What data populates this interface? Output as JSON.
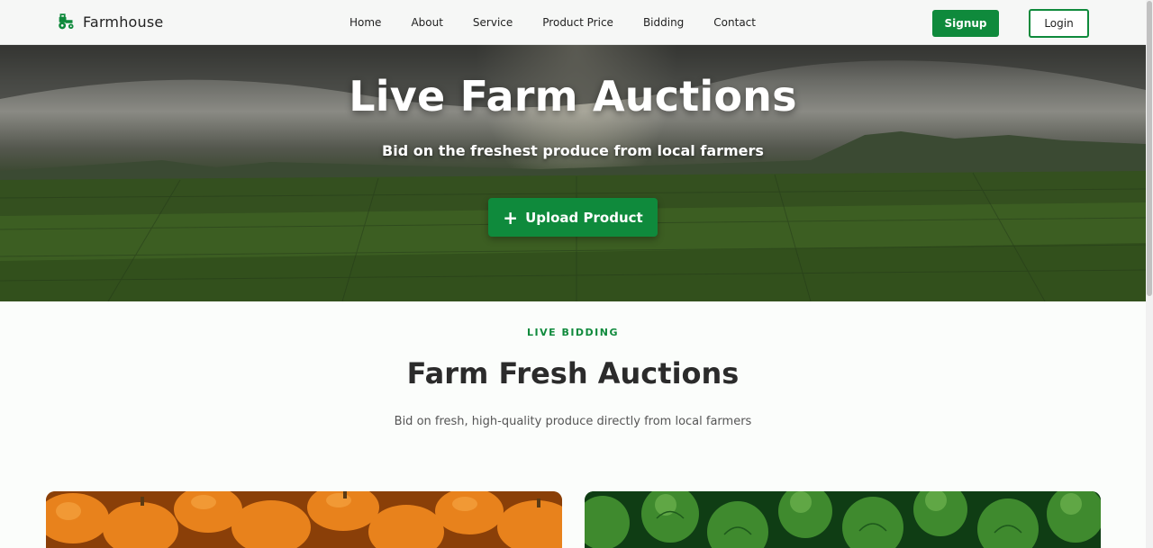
{
  "nav": {
    "brand": "Farmhouse",
    "logo_icon": "tractor-icon",
    "links": [
      "Home",
      "About",
      "Service",
      "Product Price",
      "Bidding",
      "Contact"
    ],
    "signup_label": "Signup",
    "login_label": "Login"
  },
  "hero": {
    "title": "Live Farm Auctions",
    "subtitle": "Bid on the freshest produce from local farmers",
    "upload_label": "Upload Product",
    "upload_icon": "plus-icon"
  },
  "section": {
    "tag": "LIVE BIDDING",
    "title": "Farm Fresh Auctions",
    "description": "Bid on fresh, high-quality produce directly from local farmers"
  },
  "cards": [
    {
      "image": "pumpkins-image"
    },
    {
      "image": "brussels-sprouts-image"
    }
  ],
  "colors": {
    "accent": "#0f8a3c",
    "text_dark": "#2b2b2b"
  }
}
